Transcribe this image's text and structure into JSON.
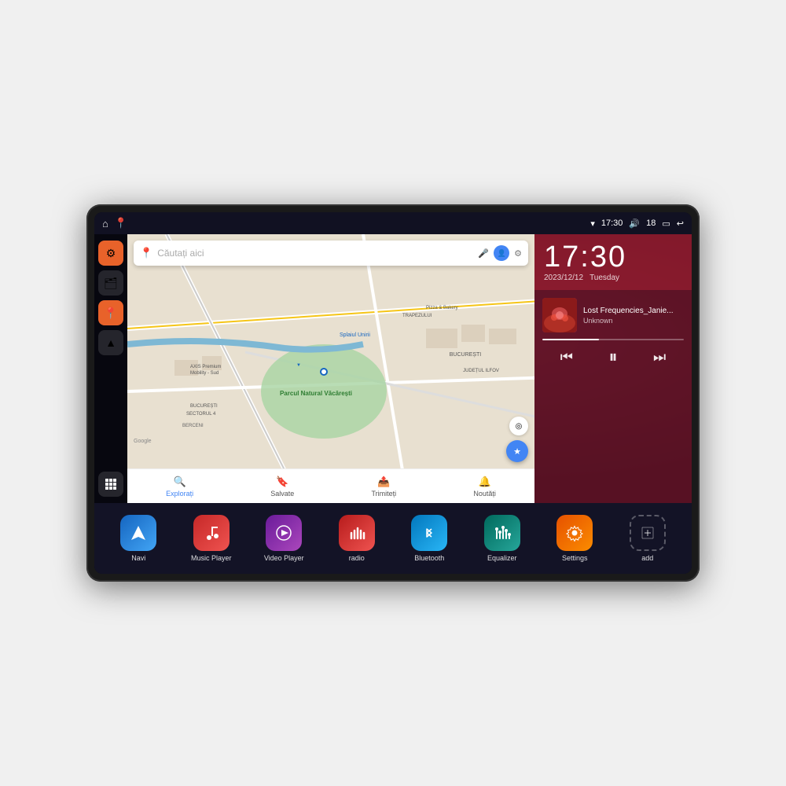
{
  "device": {
    "status_bar": {
      "wifi_icon": "▼",
      "time": "17:30",
      "volume_icon": "🔊",
      "battery_level": "18",
      "battery_icon": "🔋",
      "back_icon": "↩"
    },
    "sidebar": {
      "buttons": [
        {
          "id": "settings",
          "icon": "⚙",
          "style": "orange"
        },
        {
          "id": "files",
          "icon": "🗂",
          "style": "dark"
        },
        {
          "id": "maps",
          "icon": "📍",
          "style": "orange"
        },
        {
          "id": "navigation",
          "icon": "▲",
          "style": "dark"
        },
        {
          "id": "apps",
          "icon": "⋮⋮⋮",
          "style": "bottom"
        }
      ]
    },
    "map": {
      "search_placeholder": "Căutați aici",
      "bottom_tabs": [
        {
          "label": "Explorați",
          "icon": "🔍",
          "active": true
        },
        {
          "label": "Salvate",
          "icon": "🔖",
          "active": false
        },
        {
          "label": "Trimiteți",
          "icon": "📤",
          "active": false
        },
        {
          "label": "Noutăți",
          "icon": "🔔",
          "active": false
        }
      ],
      "places": [
        "AXIS Premium Mobility - Sud",
        "Pizza & Bakery",
        "Parcul Natural Văcărești",
        "BUCUREȘTI SECTORUL 4",
        "BUCUREȘTI",
        "JUDEȚUL ILFOV",
        "BERCENI",
        "TRAPEZULUI"
      ]
    },
    "clock": {
      "time": "17:30",
      "year": "2023/12/12",
      "day": "Tuesday"
    },
    "music": {
      "title": "Lost Frequencies_Janie...",
      "artist": "Unknown",
      "progress": 40
    },
    "apps": [
      {
        "id": "navi",
        "label": "Navi",
        "style": "blue-grad",
        "icon": "▲"
      },
      {
        "id": "music-player",
        "label": "Music Player",
        "style": "red-grad",
        "icon": "🎵"
      },
      {
        "id": "video-player",
        "label": "Video Player",
        "style": "purple-grad",
        "icon": "▶"
      },
      {
        "id": "radio",
        "label": "radio",
        "style": "dark-red-grad",
        "icon": "📻"
      },
      {
        "id": "bluetooth",
        "label": "Bluetooth",
        "style": "blue-solid",
        "icon": "✦"
      },
      {
        "id": "equalizer",
        "label": "Equalizer",
        "style": "teal-grad",
        "icon": "🎛"
      },
      {
        "id": "settings",
        "label": "Settings",
        "style": "orange-grad",
        "icon": "⚙"
      },
      {
        "id": "add",
        "label": "add",
        "style": "gray-border",
        "icon": "+"
      }
    ]
  }
}
